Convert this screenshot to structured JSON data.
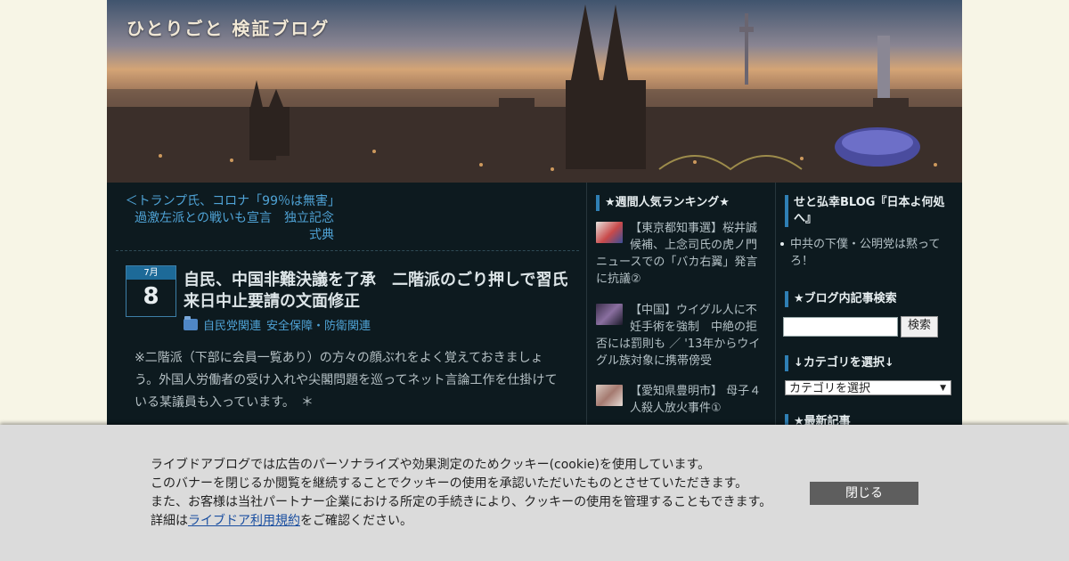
{
  "header": {
    "blog_title": "ひとりごと 検証ブログ"
  },
  "nav": {
    "prev_post": "＜トランプ氏、コロナ「99％は無害」　過激左派との戦いも宣言　独立記念式典"
  },
  "post": {
    "month": "7月",
    "day": "8",
    "title": "自民、中国非難決議を了承　二階派のごり押しで習氏来日中止要請の文面修正",
    "categories": [
      "自民党関連",
      "安全保障・防衛関連"
    ],
    "body": "※二階派（下部に会員一覧あり）の方々の顔ぶれをよく覚えておきましょう。外国人労働者の受け入れや尖閣問題を巡ってネット言論工作を仕掛けている某議員も入っています。　＊"
  },
  "ranking": {
    "heading": "★週間人気ランキング★",
    "items": [
      {
        "title": "【東京都知事選】桜井誠候補、上念司氏の虎ノ門ニュースでの「バカ右翼」発言に抗議②"
      },
      {
        "title": "【中国】ウイグル人に不妊手術を強制　中絶の拒否には罰則も ／ '13年からウイグル族対象に携帯傍受"
      },
      {
        "title": "【愛知県豊明市】 母子４人殺人放火事件①"
      }
    ]
  },
  "right": {
    "blog_heading": "せと弘幸BLOG『日本よ何処へ』",
    "blog_link": "中共の下僕・公明党は黙ってろ！",
    "search_heading": "★ブログ内記事検索",
    "search_button": "検索",
    "search_value": "",
    "category_heading": "↓カテゴリを選択↓",
    "category_select": "カテゴリを選択",
    "latest_heading": "★最新記事"
  },
  "cookie": {
    "line1": "ライブドアブログでは広告のパーソナライズや効果測定のためクッキー(cookie)を使用しています。",
    "line2": "このバナーを閉じるか閲覧を継続することでクッキーの使用を承認いただいたものとさせていただきます。",
    "line3": "また、お客様は当社パートナー企業における所定の手続きにより、クッキーの使用を管理することもできます。",
    "detail_prefix": "詳細は",
    "detail_link": "ライブドア利用規約",
    "detail_suffix": "をご確認ください。",
    "close_button": "閉じる"
  },
  "colors": {
    "accent": "#2f7fb4",
    "link": "#4fa3d6",
    "page_bg": "#0d1a1f"
  }
}
